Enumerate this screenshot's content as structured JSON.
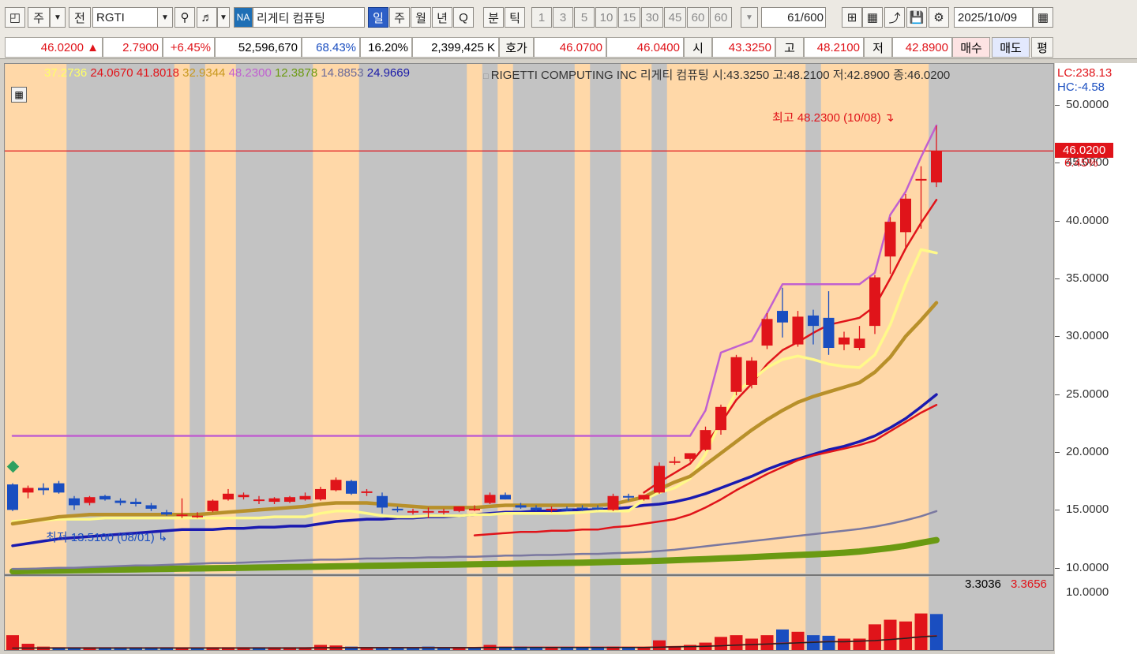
{
  "toolbar": {
    "market_label": "주",
    "type_label": "전",
    "symbol": "RGTI",
    "na_badge": "NA",
    "stock_name": "리게티 컴퓨팅",
    "period_tabs": [
      "일",
      "주",
      "월",
      "년",
      "Q"
    ],
    "selected_period": "일",
    "intraday_tabs": [
      "분",
      "틱"
    ],
    "minute_options": [
      "1",
      "3",
      "5",
      "10",
      "15",
      "30",
      "45",
      "60",
      "60"
    ],
    "count": "61",
    "count_max": "/600",
    "date": "2025/10/09"
  },
  "quote": {
    "price": "46.0200",
    "change": "2.7900",
    "change_pct": "+6.45%",
    "volume": "52,596,670",
    "vol_ratio": "68.43%",
    "turnover": "16.20%",
    "amount": "2,399,425 K",
    "bid_ask_label": "호가",
    "ask": "46.0700",
    "bid": "46.0400",
    "open_label": "시",
    "open": "43.3250",
    "high_label": "고",
    "high": "48.2100",
    "low_label": "저",
    "low": "42.8900",
    "buy_label": "매수",
    "sell_label": "매도",
    "avg_label": "평"
  },
  "legend": [
    {
      "text": "37.2736",
      "color": "#ffff66"
    },
    {
      "text": "24.0670",
      "color": "#e0141a"
    },
    {
      "text": "41.8018",
      "color": "#e0141a"
    },
    {
      "text": "32.9344",
      "color": "#c8981e"
    },
    {
      "text": "48.2300",
      "color": "#c060d0"
    },
    {
      "text": "12.3878",
      "color": "#6b9a10"
    },
    {
      "text": "14.8853",
      "color": "#6a6a9a"
    },
    {
      "text": "24.9669",
      "color": "#1a1aa8"
    }
  ],
  "title_line": "RIGETTI COMPUTING INC  리게티 컴퓨팅 시:43.3250 고:48.2100 저:42.8900 종:46.0200",
  "axis_side": {
    "lc": "LC:238.13",
    "hc": "HC:-4.58",
    "current_price": "46.0200",
    "current_pct": "6.45%"
  },
  "annotations": {
    "max_label": "최고 48.2300 (10/08)",
    "min_label": "최저 13.5100 (08/01)"
  },
  "volume_values": {
    "v1": "3.3036",
    "v2": "3.3656"
  },
  "colors": {
    "up": "#e0141a",
    "down": "#1a4ec0",
    "bg_orange": "#ffd8a8",
    "bg_gray": "#c3c3c3"
  },
  "chart_data": {
    "type": "candlestick",
    "title": "RIGETTI COMPUTING INC",
    "x_range": [
      1,
      61
    ],
    "ylim": [
      9.5,
      53
    ],
    "y_ticks": [
      "10.0000",
      "15.0000",
      "20.0000",
      "25.0000",
      "30.0000",
      "35.0000",
      "40.0000",
      "45.0000",
      "50.0000"
    ],
    "volume_ylim": [
      0,
      12
    ],
    "volume_ticks": [
      "10.0000"
    ],
    "bands": [
      "O",
      "O",
      "O",
      "O",
      "G",
      "G",
      "G",
      "G",
      "G",
      "G",
      "G",
      "O",
      "G",
      "O",
      "O",
      "G",
      "G",
      "G",
      "G",
      "G",
      "O",
      "O",
      "O",
      "G",
      "G",
      "G",
      "G",
      "G",
      "G",
      "G",
      "O",
      "G",
      "O",
      "G",
      "G",
      "G",
      "G",
      "O",
      "G",
      "G",
      "O",
      "O",
      "G",
      "O",
      "O",
      "O",
      "O",
      "O",
      "O",
      "O",
      "O",
      "O",
      "G",
      "O",
      "O",
      "O",
      "O",
      "O",
      "O",
      "O",
      "G"
    ],
    "ohlc": [
      [
        17.2,
        17.3,
        14.9,
        15.0
      ],
      [
        16.5,
        17.1,
        16.0,
        16.9
      ],
      [
        16.9,
        17.3,
        16.3,
        16.7
      ],
      [
        17.3,
        17.5,
        16.4,
        16.5
      ],
      [
        16.0,
        16.2,
        15.0,
        15.4
      ],
      [
        15.6,
        16.2,
        15.4,
        16.1
      ],
      [
        16.2,
        16.3,
        15.8,
        15.9
      ],
      [
        15.8,
        16.0,
        15.4,
        15.6
      ],
      [
        15.7,
        16.0,
        15.3,
        15.5
      ],
      [
        15.4,
        15.6,
        14.9,
        15.1
      ],
      [
        14.8,
        15.0,
        14.5,
        14.6
      ],
      [
        14.6,
        16.0,
        14.3,
        14.6
      ],
      [
        14.5,
        14.8,
        14.3,
        14.5
      ],
      [
        14.9,
        15.9,
        14.8,
        15.8
      ],
      [
        15.9,
        16.8,
        15.8,
        16.4
      ],
      [
        16.1,
        16.5,
        15.9,
        16.3
      ],
      [
        15.8,
        16.2,
        15.5,
        15.9
      ],
      [
        15.7,
        16.1,
        15.5,
        16.0
      ],
      [
        15.7,
        16.2,
        15.6,
        16.1
      ],
      [
        15.9,
        16.5,
        15.8,
        16.2
      ],
      [
        15.9,
        17.0,
        15.8,
        16.8
      ],
      [
        16.7,
        17.8,
        16.6,
        17.6
      ],
      [
        17.5,
        17.6,
        16.3,
        16.4
      ],
      [
        16.6,
        16.8,
        16.2,
        16.6
      ],
      [
        16.2,
        16.5,
        14.7,
        15.2
      ],
      [
        15.1,
        15.3,
        14.8,
        15.0
      ],
      [
        14.9,
        15.1,
        14.6,
        14.9
      ],
      [
        14.9,
        15.2,
        14.3,
        14.9
      ],
      [
        14.9,
        15.1,
        14.6,
        14.9
      ],
      [
        14.9,
        15.3,
        14.8,
        15.3
      ],
      [
        15.1,
        15.4,
        14.9,
        15.1
      ],
      [
        15.6,
        16.5,
        15.5,
        16.3
      ],
      [
        16.3,
        16.5,
        15.9,
        15.9
      ],
      [
        15.4,
        15.6,
        15.1,
        15.2
      ],
      [
        15.2,
        15.4,
        14.9,
        15.0
      ],
      [
        15.0,
        15.3,
        14.8,
        15.1
      ],
      [
        15.1,
        15.3,
        14.9,
        15.0
      ],
      [
        15.2,
        15.4,
        14.9,
        15.1
      ],
      [
        15.2,
        15.4,
        15.0,
        15.1
      ],
      [
        15.0,
        16.4,
        14.9,
        16.2
      ],
      [
        16.2,
        16.4,
        15.8,
        16.1
      ],
      [
        15.9,
        16.3,
        15.8,
        16.3
      ],
      [
        16.5,
        19.1,
        16.4,
        18.8
      ],
      [
        19.1,
        19.6,
        18.9,
        19.2
      ],
      [
        19.4,
        19.9,
        19.2,
        19.9
      ],
      [
        20.2,
        22.2,
        20.1,
        21.9
      ],
      [
        21.9,
        24.1,
        21.5,
        23.9
      ],
      [
        25.2,
        28.4,
        24.9,
        28.2
      ],
      [
        25.8,
        28.2,
        25.5,
        27.9
      ],
      [
        29.2,
        32.0,
        28.9,
        31.5
      ],
      [
        32.2,
        34.2,
        29.9,
        31.2
      ],
      [
        29.3,
        32.2,
        29.1,
        31.7
      ],
      [
        31.8,
        32.3,
        29.3,
        30.9
      ],
      [
        31.6,
        33.9,
        28.4,
        29.0
      ],
      [
        29.3,
        30.4,
        28.8,
        29.9
      ],
      [
        29.0,
        30.9,
        28.8,
        29.8
      ],
      [
        30.9,
        35.3,
        30.2,
        35.1
      ],
      [
        36.9,
        40.3,
        35.4,
        39.9
      ],
      [
        39.0,
        42.3,
        37.6,
        41.9
      ],
      [
        43.5,
        44.7,
        39.3,
        43.6
      ],
      [
        43.3,
        48.2,
        42.9,
        46.0
      ]
    ],
    "volume": [
      2.6,
      1.1,
      0.6,
      0.5,
      0.5,
      0.5,
      0.5,
      0.5,
      0.5,
      0.5,
      0.5,
      0.4,
      0.4,
      0.5,
      0.5,
      0.5,
      0.5,
      0.5,
      0.5,
      0.5,
      0.9,
      0.8,
      0.6,
      0.5,
      0.5,
      0.5,
      0.5,
      0.6,
      0.5,
      0.5,
      0.5,
      0.9,
      0.6,
      0.6,
      0.5,
      0.5,
      0.5,
      0.5,
      0.5,
      0.6,
      0.5,
      0.5,
      1.7,
      0.7,
      0.9,
      1.3,
      2.3,
      2.6,
      2.0,
      2.6,
      3.6,
      3.2,
      2.6,
      2.5,
      2.0,
      2.0,
      4.5,
      5.3,
      5.0,
      6.4,
      6.3
    ],
    "volume_up": [
      1,
      1,
      1,
      0,
      0,
      1,
      0,
      0,
      0,
      0,
      0,
      1,
      0,
      1,
      1,
      1,
      0,
      1,
      1,
      1,
      1,
      1,
      0,
      1,
      0,
      0,
      0,
      0,
      0,
      1,
      0,
      1,
      0,
      0,
      0,
      1,
      0,
      0,
      0,
      1,
      0,
      1,
      1,
      1,
      1,
      1,
      1,
      1,
      1,
      1,
      0,
      1,
      0,
      0,
      1,
      1,
      1,
      1,
      1,
      1,
      0
    ],
    "series": [
      {
        "name": "37.2736",
        "color": "#fff98a",
        "width": 3.5,
        "values": [
          14.0,
          14.1,
          14.1,
          14.2,
          14.2,
          14.2,
          14.3,
          14.3,
          14.3,
          14.3,
          14.3,
          14.3,
          14.3,
          14.3,
          14.3,
          14.3,
          14.3,
          14.4,
          14.4,
          14.4,
          14.7,
          14.9,
          14.9,
          14.7,
          14.5,
          14.4,
          14.4,
          14.5,
          14.5,
          14.5,
          14.6,
          14.6,
          14.7,
          14.7,
          14.7,
          14.7,
          14.7,
          14.8,
          14.9,
          14.9,
          14.9,
          15.9,
          16.5,
          16.9,
          17.7,
          19.8,
          22.7,
          25.2,
          26.2,
          27.3,
          28.0,
          28.3,
          28.0,
          27.6,
          27.4,
          27.3,
          28.4,
          31.0,
          34.5,
          37.5,
          37.2
        ]
      },
      {
        "name": "32.9344",
        "color": "#b8902a",
        "width": 4.5,
        "values": [
          13.8,
          14.0,
          14.2,
          14.4,
          14.5,
          14.6,
          14.6,
          14.6,
          14.6,
          14.6,
          14.6,
          14.6,
          14.6,
          14.7,
          14.8,
          14.9,
          15.0,
          15.1,
          15.2,
          15.3,
          15.5,
          15.6,
          15.6,
          15.6,
          15.5,
          15.4,
          15.3,
          15.2,
          15.2,
          15.2,
          15.2,
          15.3,
          15.4,
          15.4,
          15.4,
          15.4,
          15.4,
          15.4,
          15.4,
          15.5,
          15.8,
          16.1,
          16.8,
          17.4,
          17.9,
          18.9,
          19.9,
          20.9,
          21.9,
          22.8,
          23.6,
          24.3,
          24.8,
          25.2,
          25.6,
          26.0,
          26.9,
          28.2,
          30.0,
          31.4,
          32.9
        ]
      },
      {
        "name": "24.9669",
        "color": "#1a1ab0",
        "width": 3.5,
        "values": [
          11.9,
          12.1,
          12.3,
          12.5,
          12.6,
          12.7,
          12.8,
          12.9,
          13.0,
          13.1,
          13.2,
          13.3,
          13.3,
          13.3,
          13.4,
          13.4,
          13.5,
          13.5,
          13.6,
          13.6,
          13.8,
          14.0,
          14.1,
          14.2,
          14.2,
          14.3,
          14.3,
          14.4,
          14.4,
          14.5,
          14.6,
          14.7,
          14.8,
          14.8,
          14.9,
          14.9,
          15.0,
          15.0,
          15.0,
          15.1,
          15.2,
          15.4,
          15.5,
          15.7,
          16.0,
          16.4,
          16.9,
          17.4,
          17.9,
          18.5,
          19.0,
          19.4,
          19.8,
          20.2,
          20.5,
          20.9,
          21.4,
          22.1,
          22.9,
          23.9,
          24.97
        ]
      },
      {
        "name": "24.0670",
        "color": "#e0141a",
        "width": 2.5,
        "values": [
          null,
          null,
          null,
          null,
          null,
          null,
          null,
          null,
          null,
          null,
          null,
          null,
          null,
          null,
          null,
          null,
          null,
          null,
          null,
          null,
          null,
          null,
          null,
          null,
          null,
          null,
          null,
          null,
          null,
          null,
          12.8,
          12.9,
          13.0,
          13.1,
          13.1,
          13.2,
          13.2,
          13.3,
          13.3,
          13.5,
          13.6,
          13.8,
          14.0,
          14.2,
          14.6,
          15.2,
          15.9,
          16.7,
          17.4,
          18.1,
          18.7,
          19.3,
          19.7,
          20.0,
          20.3,
          20.6,
          21.0,
          21.8,
          22.6,
          23.4,
          24.07
        ]
      },
      {
        "name": "41.8018",
        "color": "#e0141a",
        "width": 2.5,
        "values": [
          null,
          null,
          null,
          null,
          null,
          null,
          null,
          null,
          null,
          null,
          null,
          null,
          null,
          null,
          null,
          null,
          null,
          null,
          null,
          null,
          null,
          null,
          null,
          null,
          null,
          null,
          null,
          null,
          null,
          null,
          null,
          null,
          null,
          null,
          null,
          null,
          null,
          null,
          null,
          null,
          null,
          16.5,
          17.4,
          18.2,
          19.0,
          20.6,
          22.5,
          24.5,
          25.9,
          27.6,
          28.8,
          29.5,
          30.3,
          31.0,
          31.3,
          31.6,
          32.6,
          35.0,
          37.6,
          39.8,
          41.8
        ]
      },
      {
        "name": "48.2300",
        "color": "#c060d0",
        "width": 2.5,
        "values": [
          21.4,
          21.4,
          21.4,
          21.4,
          21.4,
          21.4,
          21.4,
          21.4,
          21.4,
          21.4,
          21.4,
          21.4,
          21.4,
          21.4,
          21.4,
          21.4,
          21.4,
          21.4,
          21.4,
          21.4,
          21.4,
          21.4,
          21.4,
          21.4,
          21.4,
          21.4,
          21.4,
          21.4,
          21.4,
          21.4,
          21.4,
          21.4,
          21.4,
          21.4,
          21.4,
          21.4,
          21.4,
          21.4,
          21.4,
          21.4,
          21.4,
          21.4,
          21.4,
          21.4,
          21.4,
          23.6,
          28.6,
          29.1,
          29.6,
          32.0,
          34.5,
          34.5,
          34.5,
          34.5,
          34.5,
          34.5,
          35.5,
          40.5,
          42.5,
          45.5,
          48.23
        ]
      },
      {
        "name": "14.8853",
        "color": "#7a78a0",
        "width": 2.5,
        "values": [
          9.9,
          9.9,
          9.95,
          10.0,
          10.0,
          10.05,
          10.1,
          10.15,
          10.2,
          10.2,
          10.25,
          10.3,
          10.35,
          10.4,
          10.4,
          10.45,
          10.5,
          10.55,
          10.6,
          10.65,
          10.7,
          10.7,
          10.75,
          10.8,
          10.8,
          10.85,
          10.85,
          10.9,
          10.9,
          10.95,
          10.95,
          11.0,
          11.05,
          11.05,
          11.1,
          11.1,
          11.15,
          11.2,
          11.2,
          11.25,
          11.3,
          11.35,
          11.45,
          11.55,
          11.7,
          11.85,
          12.0,
          12.15,
          12.3,
          12.45,
          12.6,
          12.75,
          12.9,
          13.05,
          13.2,
          13.35,
          13.55,
          13.8,
          14.1,
          14.45,
          14.89
        ]
      },
      {
        "name": "12.3878",
        "color": "#6a9a12",
        "width": 8,
        "values": [
          9.7,
          9.72,
          9.74,
          9.76,
          9.78,
          9.8,
          9.82,
          9.84,
          9.86,
          9.88,
          9.9,
          9.92,
          9.94,
          9.96,
          9.98,
          10.0,
          10.02,
          10.04,
          10.06,
          10.08,
          10.1,
          10.12,
          10.14,
          10.16,
          10.18,
          10.2,
          10.22,
          10.24,
          10.26,
          10.28,
          10.3,
          10.32,
          10.34,
          10.36,
          10.38,
          10.4,
          10.42,
          10.44,
          10.47,
          10.5,
          10.53,
          10.56,
          10.6,
          10.65,
          10.7,
          10.75,
          10.8,
          10.86,
          10.92,
          10.98,
          11.04,
          11.1,
          11.16,
          11.22,
          11.3,
          11.4,
          11.55,
          11.7,
          11.9,
          12.15,
          12.39
        ]
      },
      {
        "name": "volume_ma_a",
        "color": "#e0141a",
        "width": 1.5,
        "volume": true,
        "values": [
          0.4,
          0.4,
          0.4,
          0.4,
          0.4,
          0.4,
          0.4,
          0.4,
          0.4,
          0.4,
          0.4,
          0.4,
          0.4,
          0.4,
          0.4,
          0.4,
          0.4,
          0.4,
          0.4,
          0.4,
          0.45,
          0.45,
          0.45,
          0.45,
          0.45,
          0.45,
          0.45,
          0.45,
          0.45,
          0.45,
          0.45,
          0.5,
          0.5,
          0.5,
          0.5,
          0.5,
          0.5,
          0.5,
          0.5,
          0.5,
          0.5,
          0.5,
          0.55,
          0.6,
          0.65,
          0.7,
          0.8,
          0.9,
          1.0,
          1.1,
          1.2,
          1.3,
          1.4,
          1.5,
          1.5,
          1.6,
          1.7,
          1.9,
          2.1,
          2.4,
          2.5
        ]
      },
      {
        "name": "volume_ma_b",
        "color": "#222222",
        "width": 1.5,
        "volume": true,
        "values": [
          0.35,
          0.35,
          0.35,
          0.35,
          0.35,
          0.35,
          0.35,
          0.35,
          0.35,
          0.35,
          0.35,
          0.35,
          0.35,
          0.35,
          0.35,
          0.35,
          0.35,
          0.35,
          0.35,
          0.35,
          0.4,
          0.4,
          0.4,
          0.4,
          0.4,
          0.4,
          0.4,
          0.4,
          0.4,
          0.4,
          0.4,
          0.45,
          0.45,
          0.45,
          0.45,
          0.45,
          0.45,
          0.45,
          0.45,
          0.45,
          0.45,
          0.45,
          0.5,
          0.55,
          0.6,
          0.65,
          0.75,
          0.85,
          0.95,
          1.05,
          1.15,
          1.25,
          1.35,
          1.45,
          1.45,
          1.55,
          1.65,
          1.85,
          2.05,
          2.3,
          2.45
        ]
      }
    ],
    "hlines": [
      {
        "value": 46.02,
        "color": "#e0141a"
      }
    ]
  }
}
